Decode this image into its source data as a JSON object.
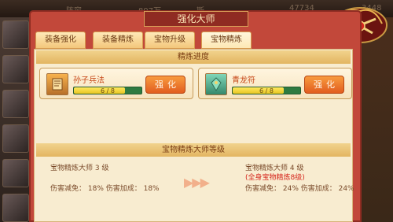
{
  "topbar": {
    "left_text": "阵容",
    "mid_value": "897万",
    "right_value": "47734",
    "right_value2": "3448",
    "mid_symbol": "斯"
  },
  "window": {
    "title": "强化大师"
  },
  "tabs": [
    {
      "label": "装备强化",
      "active": false
    },
    {
      "label": "装备精炼",
      "active": false
    },
    {
      "label": "宝物升级",
      "active": false
    },
    {
      "label": "宝物精炼",
      "active": true
    }
  ],
  "progress": {
    "title": "精炼进度",
    "items": [
      {
        "name": "孙子兵法",
        "current": 6,
        "max": 8,
        "text": "6 / 8",
        "button": "强化",
        "icon": "scroll-icon"
      },
      {
        "name": "青龙符",
        "current": 6,
        "max": 8,
        "text": "6 / 8",
        "button": "强化",
        "icon": "jade-token-icon"
      }
    ]
  },
  "master": {
    "title": "宝物精炼大师等级",
    "current": {
      "level": "宝物精炼大师 3 级",
      "stats": "伤害减免：  18%    伤害加成：  18%"
    },
    "next": {
      "level": "宝物精炼大师 4 级",
      "requirement": "(全身宝物精炼8级)",
      "stats": "伤害减免：  24%    伤害加成：  24%"
    },
    "arrows": "▶▶▶"
  },
  "colors": {
    "accent": "#c64616",
    "button": "#e15d20",
    "panel": "#f8ecd0",
    "bar_fill": "#ffe85d"
  }
}
